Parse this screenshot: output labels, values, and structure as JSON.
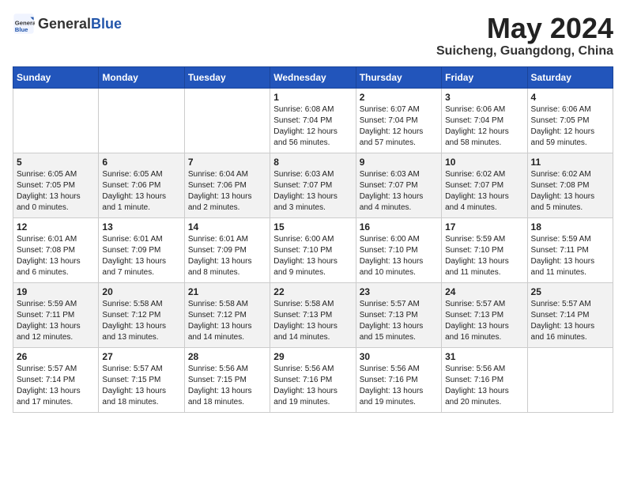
{
  "header": {
    "logo_general": "General",
    "logo_blue": "Blue",
    "month": "May 2024",
    "location": "Suicheng, Guangdong, China"
  },
  "weekdays": [
    "Sunday",
    "Monday",
    "Tuesday",
    "Wednesday",
    "Thursday",
    "Friday",
    "Saturday"
  ],
  "weeks": [
    [
      {
        "day": "",
        "info": ""
      },
      {
        "day": "",
        "info": ""
      },
      {
        "day": "",
        "info": ""
      },
      {
        "day": "1",
        "info": "Sunrise: 6:08 AM\nSunset: 7:04 PM\nDaylight: 12 hours\nand 56 minutes."
      },
      {
        "day": "2",
        "info": "Sunrise: 6:07 AM\nSunset: 7:04 PM\nDaylight: 12 hours\nand 57 minutes."
      },
      {
        "day": "3",
        "info": "Sunrise: 6:06 AM\nSunset: 7:04 PM\nDaylight: 12 hours\nand 58 minutes."
      },
      {
        "day": "4",
        "info": "Sunrise: 6:06 AM\nSunset: 7:05 PM\nDaylight: 12 hours\nand 59 minutes."
      }
    ],
    [
      {
        "day": "5",
        "info": "Sunrise: 6:05 AM\nSunset: 7:05 PM\nDaylight: 13 hours\nand 0 minutes."
      },
      {
        "day": "6",
        "info": "Sunrise: 6:05 AM\nSunset: 7:06 PM\nDaylight: 13 hours\nand 1 minute."
      },
      {
        "day": "7",
        "info": "Sunrise: 6:04 AM\nSunset: 7:06 PM\nDaylight: 13 hours\nand 2 minutes."
      },
      {
        "day": "8",
        "info": "Sunrise: 6:03 AM\nSunset: 7:07 PM\nDaylight: 13 hours\nand 3 minutes."
      },
      {
        "day": "9",
        "info": "Sunrise: 6:03 AM\nSunset: 7:07 PM\nDaylight: 13 hours\nand 4 minutes."
      },
      {
        "day": "10",
        "info": "Sunrise: 6:02 AM\nSunset: 7:07 PM\nDaylight: 13 hours\nand 4 minutes."
      },
      {
        "day": "11",
        "info": "Sunrise: 6:02 AM\nSunset: 7:08 PM\nDaylight: 13 hours\nand 5 minutes."
      }
    ],
    [
      {
        "day": "12",
        "info": "Sunrise: 6:01 AM\nSunset: 7:08 PM\nDaylight: 13 hours\nand 6 minutes."
      },
      {
        "day": "13",
        "info": "Sunrise: 6:01 AM\nSunset: 7:09 PM\nDaylight: 13 hours\nand 7 minutes."
      },
      {
        "day": "14",
        "info": "Sunrise: 6:01 AM\nSunset: 7:09 PM\nDaylight: 13 hours\nand 8 minutes."
      },
      {
        "day": "15",
        "info": "Sunrise: 6:00 AM\nSunset: 7:10 PM\nDaylight: 13 hours\nand 9 minutes."
      },
      {
        "day": "16",
        "info": "Sunrise: 6:00 AM\nSunset: 7:10 PM\nDaylight: 13 hours\nand 10 minutes."
      },
      {
        "day": "17",
        "info": "Sunrise: 5:59 AM\nSunset: 7:10 PM\nDaylight: 13 hours\nand 11 minutes."
      },
      {
        "day": "18",
        "info": "Sunrise: 5:59 AM\nSunset: 7:11 PM\nDaylight: 13 hours\nand 11 minutes."
      }
    ],
    [
      {
        "day": "19",
        "info": "Sunrise: 5:59 AM\nSunset: 7:11 PM\nDaylight: 13 hours\nand 12 minutes."
      },
      {
        "day": "20",
        "info": "Sunrise: 5:58 AM\nSunset: 7:12 PM\nDaylight: 13 hours\nand 13 minutes."
      },
      {
        "day": "21",
        "info": "Sunrise: 5:58 AM\nSunset: 7:12 PM\nDaylight: 13 hours\nand 14 minutes."
      },
      {
        "day": "22",
        "info": "Sunrise: 5:58 AM\nSunset: 7:13 PM\nDaylight: 13 hours\nand 14 minutes."
      },
      {
        "day": "23",
        "info": "Sunrise: 5:57 AM\nSunset: 7:13 PM\nDaylight: 13 hours\nand 15 minutes."
      },
      {
        "day": "24",
        "info": "Sunrise: 5:57 AM\nSunset: 7:13 PM\nDaylight: 13 hours\nand 16 minutes."
      },
      {
        "day": "25",
        "info": "Sunrise: 5:57 AM\nSunset: 7:14 PM\nDaylight: 13 hours\nand 16 minutes."
      }
    ],
    [
      {
        "day": "26",
        "info": "Sunrise: 5:57 AM\nSunset: 7:14 PM\nDaylight: 13 hours\nand 17 minutes."
      },
      {
        "day": "27",
        "info": "Sunrise: 5:57 AM\nSunset: 7:15 PM\nDaylight: 13 hours\nand 18 minutes."
      },
      {
        "day": "28",
        "info": "Sunrise: 5:56 AM\nSunset: 7:15 PM\nDaylight: 13 hours\nand 18 minutes."
      },
      {
        "day": "29",
        "info": "Sunrise: 5:56 AM\nSunset: 7:16 PM\nDaylight: 13 hours\nand 19 minutes."
      },
      {
        "day": "30",
        "info": "Sunrise: 5:56 AM\nSunset: 7:16 PM\nDaylight: 13 hours\nand 19 minutes."
      },
      {
        "day": "31",
        "info": "Sunrise: 5:56 AM\nSunset: 7:16 PM\nDaylight: 13 hours\nand 20 minutes."
      },
      {
        "day": "",
        "info": ""
      }
    ]
  ]
}
